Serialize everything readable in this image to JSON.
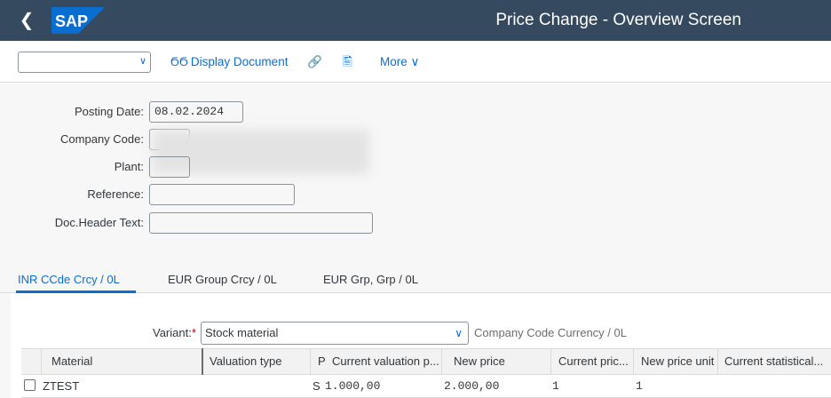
{
  "shell": {
    "title": "Price Change - Overview Screen",
    "logo_text": "SAP",
    "brand_color": "#0a6ed1",
    "bar_color": "#354a5f"
  },
  "toolbar": {
    "select_value": "",
    "display_document": "Display Document",
    "more": "More"
  },
  "header": {
    "posting_date_label": "Posting Date:",
    "posting_date_value": "08.02.2024",
    "company_code_label": "Company Code:",
    "plant_label": "Plant:",
    "reference_label": "Reference:",
    "reference_value": "",
    "doc_header_text_label": "Doc.Header Text:",
    "doc_header_text_value": ""
  },
  "tabs": [
    {
      "label": "INR  CCde Crcy / 0L",
      "active": true
    },
    {
      "label": "EUR  Group Crcy / 0L",
      "active": false
    },
    {
      "label": "EUR  Grp, Grp / 0L",
      "active": false
    }
  ],
  "variant": {
    "label": "Variant:",
    "required_mark": "*",
    "value": "Stock material",
    "currency_label": "Company Code Currency / 0L"
  },
  "grid": {
    "columns": [
      "Material",
      "Valuation type",
      "P",
      "Current valuation p...",
      "New price",
      "Current pric...",
      "New price unit",
      "Current statistical..."
    ],
    "rows": [
      {
        "material": "ZTEST",
        "valuation_type": "",
        "p": "S",
        "current_valuation_price": "1.000,00",
        "new_price": "2.000,00",
        "current_price_unit": "1",
        "new_price_unit": "1",
        "current_statistical": ""
      }
    ]
  }
}
